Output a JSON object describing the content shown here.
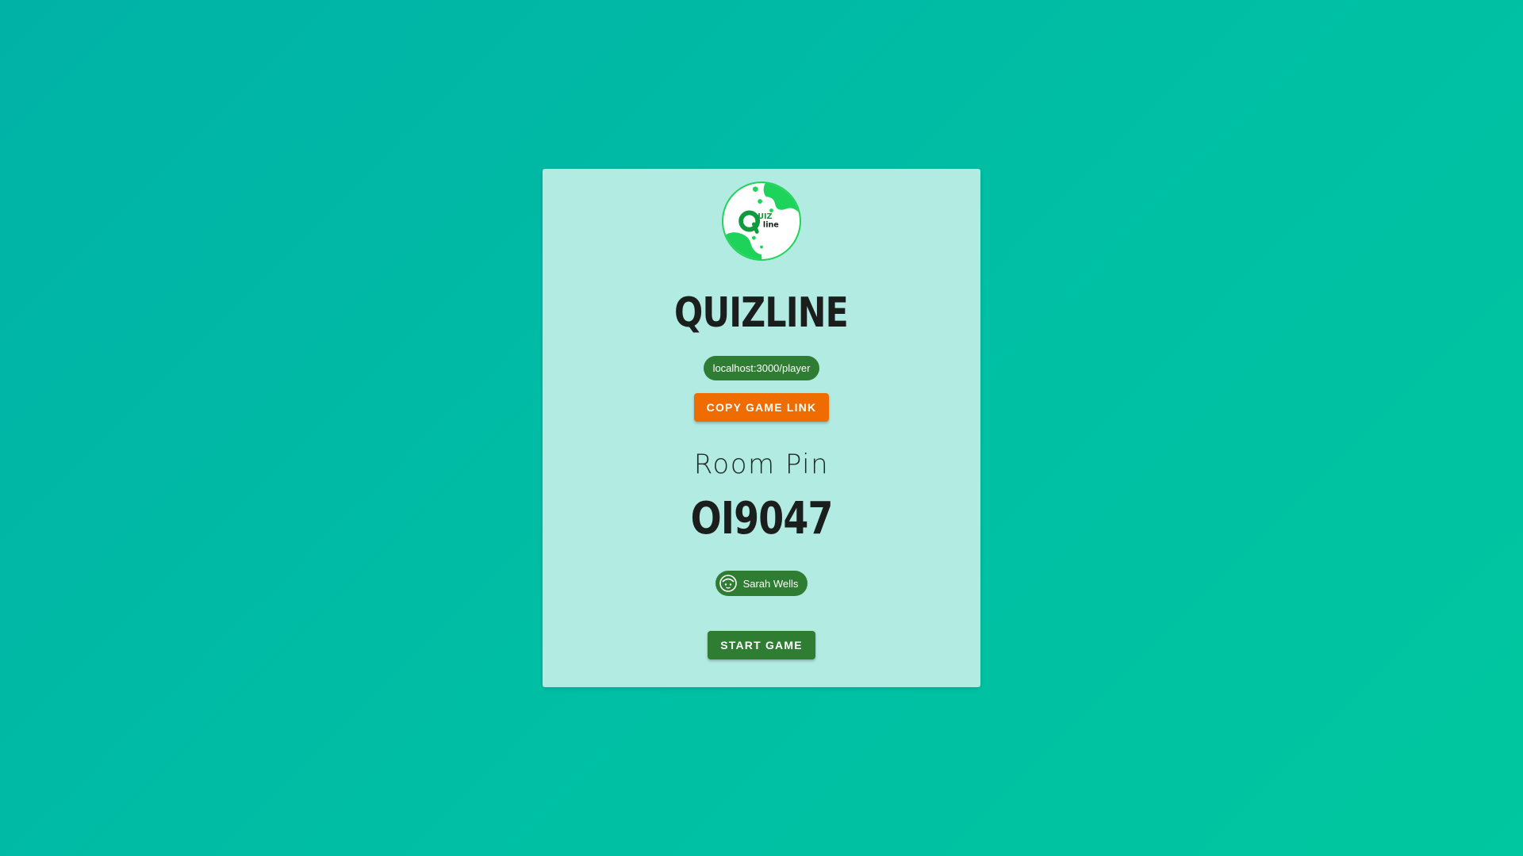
{
  "app": {
    "title": "QUIZLINE",
    "logo_icon": "quizline-logo",
    "logo_text": "Quiz line"
  },
  "game": {
    "link": "localhost:3000/player",
    "copy_link_label": "COPY GAME LINK",
    "room_pin_label": "Room Pin",
    "room_pin": "OI9047",
    "start_label": "START GAME"
  },
  "players": [
    {
      "name": "Sarah Wells",
      "avatar_icon": "face-icon"
    }
  ],
  "colors": {
    "background": "#00b8a5",
    "card": "#b2ebe2",
    "chip": "#2e7d32",
    "copy_button": "#ef6c00",
    "start_button": "#2e7d32",
    "logo_green": "#23d35a"
  }
}
